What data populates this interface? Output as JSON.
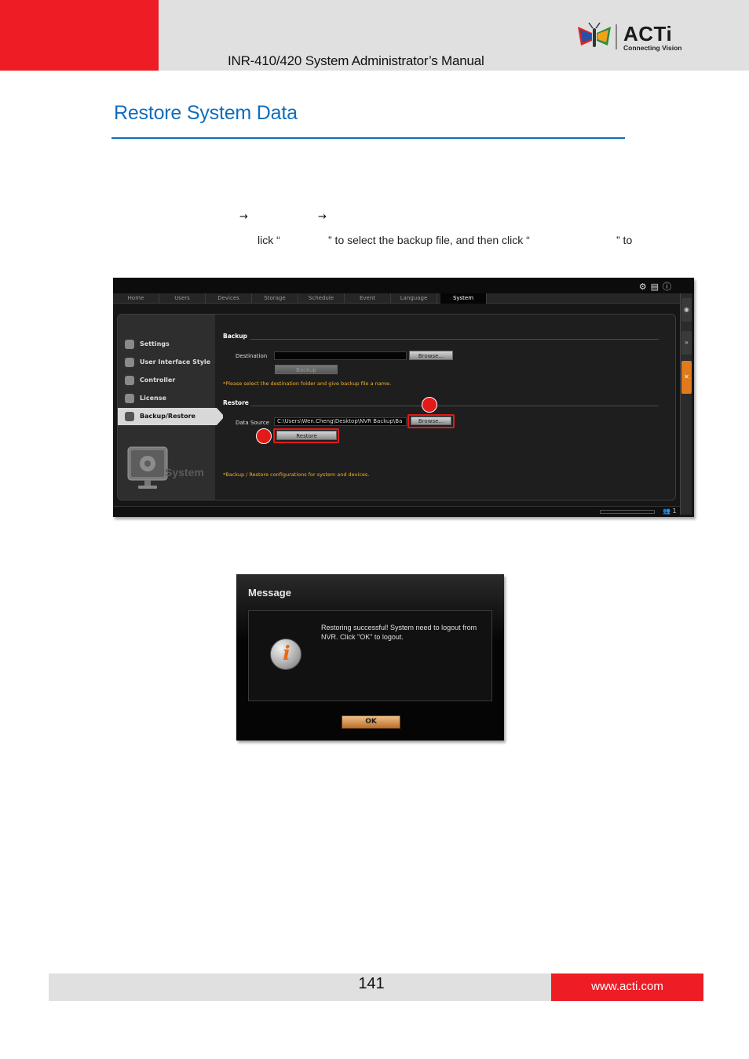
{
  "header": {
    "manual_title": "INR-410/420 System Administrator’s Manual",
    "logo_word": "ACTi",
    "logo_tagline": "Connecting Vision"
  },
  "section": {
    "title": "Restore System Data"
  },
  "instructions": {
    "arrow_1": "→",
    "arrow_2": "→",
    "frag_1": "lick “",
    "frag_2": "” to select the backup file, and then click “",
    "frag_3": "” to"
  },
  "app": {
    "tabs": [
      "Home",
      "Users",
      "Devices",
      "Storage",
      "Schedule",
      "Event",
      "Language",
      "System"
    ],
    "active_tab": "System",
    "nav": [
      "Settings",
      "User Interface Style",
      "Controller",
      "License",
      "Backup/Restore"
    ],
    "nav_active": "Backup/Restore",
    "system_label": "System",
    "backup": {
      "heading": "Backup",
      "destination_label": "Destination",
      "destination_value": "",
      "browse_label": "Browse...",
      "backup_button": "Backup",
      "note": "*Please select the destination folder and give backup file a name."
    },
    "restore": {
      "heading": "Restore",
      "source_label": "Data Source",
      "source_value": "C:\\Users\\Wen.Cheng\\Desktop\\NVR Backup\\Ba",
      "browse_label": "Browse...",
      "restore_button": "Restore"
    },
    "footer_note": "*Backup / Restore configurations for system and devices.",
    "user_count": "1"
  },
  "dialog": {
    "title": "Message",
    "message": "Restoring successful! System need to logout from NVR. Click \"OK\" to logout.",
    "ok_label": "OK"
  },
  "footer": {
    "page_number": "141",
    "url": "www.acti.com"
  },
  "colors": {
    "brand_red": "#ee1c25",
    "heading_blue": "#0f6dbd",
    "highlight_red": "#e21a1a",
    "note_orange": "#f1b32a"
  }
}
